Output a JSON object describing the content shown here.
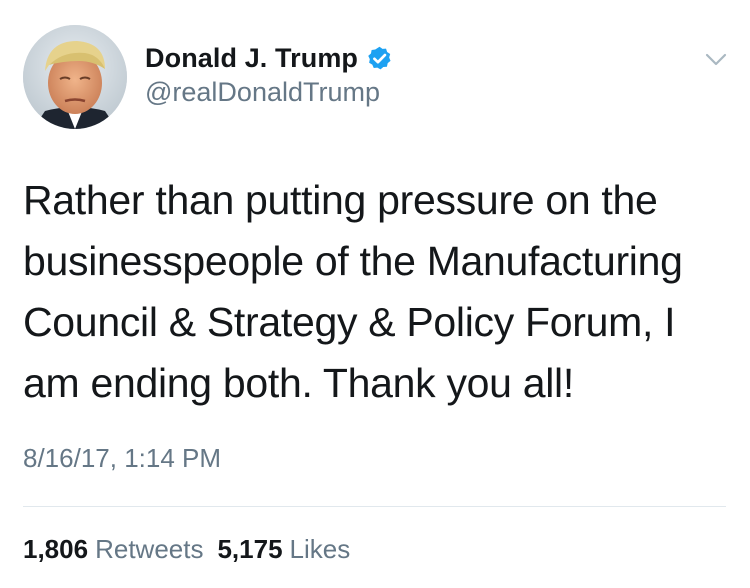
{
  "author": {
    "display_name": "Donald J. Trump",
    "handle": "@realDonaldTrump",
    "verified": true
  },
  "tweet": {
    "text": "Rather than putting pressure on the\nbusinesspeople of the Manufacturing\nCouncil & Strategy & Policy Forum, I\nam ending both. Thank you all!",
    "timestamp": "8/16/17, 1:14 PM"
  },
  "stats": {
    "retweets_count": "1,806",
    "retweets_label": "Retweets",
    "likes_count": "5,175",
    "likes_label": "Likes"
  },
  "colors": {
    "text_primary": "#14171a",
    "text_secondary": "#657786",
    "verified_badge": "#1da1f2",
    "divider": "#e1e8ed",
    "chevron": "#aab8c2"
  },
  "icons": {
    "verified": "verified-badge-icon",
    "menu": "chevron-down-icon"
  }
}
